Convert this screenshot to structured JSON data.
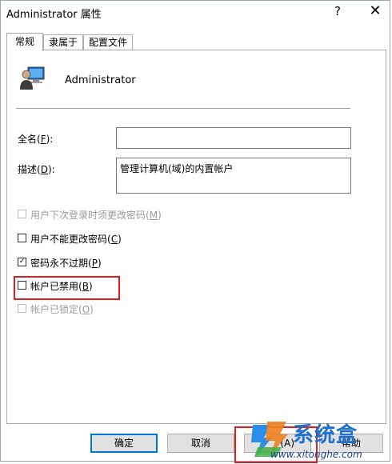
{
  "window": {
    "title": "Administrator 属性",
    "help_glyph": "?",
    "close_glyph": "✕"
  },
  "tabs": [
    {
      "label": "常规",
      "active": true
    },
    {
      "label": "隶属于",
      "active": false
    },
    {
      "label": "配置文件",
      "active": false
    }
  ],
  "user": {
    "name": "Administrator"
  },
  "fields": {
    "fullname": {
      "label_pre": "全名(",
      "accel": "F",
      "label_post": "):",
      "value": ""
    },
    "description": {
      "label_pre": "描述(",
      "accel": "D",
      "label_post": "):",
      "value": "管理计算机(域)的内置帐户"
    }
  },
  "checkboxes": [
    {
      "label": "用户下次登录时须更改密码",
      "accel": "M",
      "checked": false,
      "disabled": true
    },
    {
      "label": "用户不能更改密码",
      "accel": "C",
      "checked": false,
      "disabled": false
    },
    {
      "label": "密码永不过期",
      "accel": "P",
      "checked": true,
      "disabled": false
    },
    {
      "label": "帐户已禁用",
      "accel": "B",
      "checked": false,
      "disabled": false
    },
    {
      "label": "帐户已锁定",
      "accel": "O",
      "checked": false,
      "disabled": true
    }
  ],
  "buttons": {
    "ok": "确定",
    "cancel": "取消",
    "apply_visible": "(A)",
    "help": "帮助"
  },
  "watermark": {
    "text": "系统盒",
    "url": "www.xitonghe.com"
  }
}
